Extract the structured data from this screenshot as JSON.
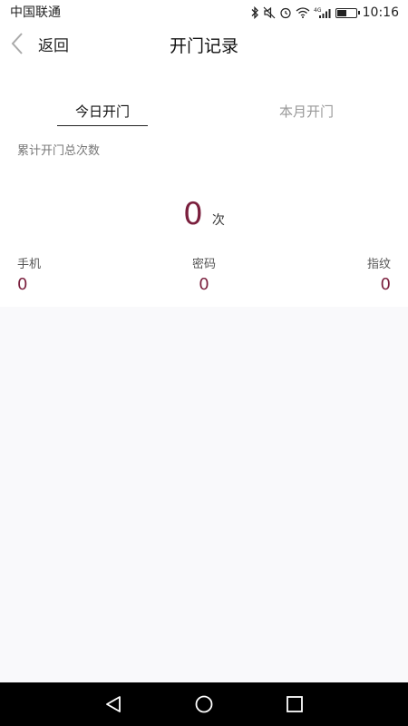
{
  "status_bar": {
    "carrier": "中国联通",
    "signal_tag": "4G",
    "time": "10:16",
    "battery_level": 0.55
  },
  "nav": {
    "back_label": "返回",
    "title": "开门记录"
  },
  "tabs": [
    {
      "label": "今日开门",
      "active": true
    },
    {
      "label": "本月开门",
      "active": false
    }
  ],
  "summary": {
    "label": "累计开门总次数",
    "total": "0",
    "unit": "次"
  },
  "stats": [
    {
      "label": "手机",
      "value": "0"
    },
    {
      "label": "密码",
      "value": "0"
    },
    {
      "label": "指纹",
      "value": "0"
    }
  ],
  "colors": {
    "accent": "#7a1f3d",
    "content_background": "#f9f9fb"
  }
}
